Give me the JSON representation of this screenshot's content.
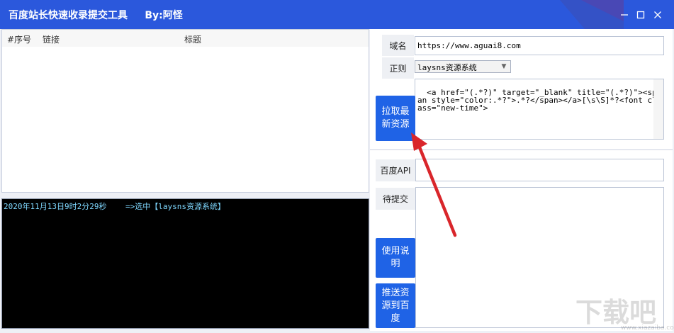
{
  "window": {
    "title": "百度站长快速收录提交工具     By:阿怪",
    "minimize_icon": "minimize-icon",
    "maximize_icon": "maximize-icon",
    "close_icon": "close-icon"
  },
  "list": {
    "columns": [
      "#序号",
      "链接",
      "标题"
    ],
    "rows": []
  },
  "log": {
    "lines": [
      "2020年11月13日9时2分29秒    =>选中【laysns资源系统】"
    ]
  },
  "form": {
    "domain_label": "域名",
    "domain_value": "https://www.aguai8.com",
    "regex_label": "正则",
    "regex_selected": "laysns资源系统",
    "regex_pattern": "<a href=\"(.*?)\" target=\"_blank\" title=\"(.*?)\"><span style=\"color:.*?\">.*?</span></a>[\\s\\S]*?<font class=\"new-time\">",
    "fetch_button": "拉取最新资源",
    "api_label": "百度API",
    "api_value": "",
    "pending_label": "待提交",
    "pending_value": "",
    "help_button": "使用说明",
    "push_button": "推送资源到百度"
  },
  "watermark": {
    "text": "下载吧",
    "sub": "www.xiazaiba.com"
  },
  "colors": {
    "titlebar": "#2b58dc",
    "button": "#1f63e6",
    "log_bg": "#000000",
    "log_text": "#7fd8ff",
    "arrow": "#d9262b"
  }
}
